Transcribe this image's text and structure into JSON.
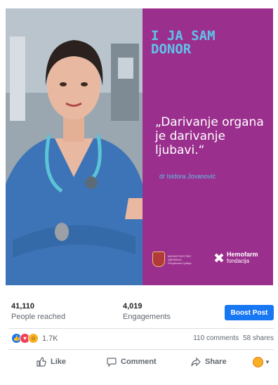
{
  "post": {
    "campaign_title_line1": "I JA SAM",
    "campaign_title_line2": "DONOR",
    "quote": "„Darivanje organa je darivanje ljubavi.“",
    "author": "dr Isidora Jovanović",
    "ministry_text": "МИНИСТАРСТВО ЗДРАВЉА Република Србија",
    "hemofarm_name": "Hemofarm",
    "hemofarm_sub": "fondacija",
    "colors": {
      "campaign_bg": "#9b2f8e",
      "accent": "#5fc2ea"
    }
  },
  "stats": {
    "reached_value": "41,110",
    "reached_label": "People reached",
    "engagements_value": "4,019",
    "engagements_label": "Engagements",
    "boost_label": "Boost Post"
  },
  "reactions": {
    "count": "1.7K",
    "comments": "110 comments",
    "shares": "58 shares",
    "icons": [
      "like-icon",
      "love-icon",
      "haha-icon"
    ]
  },
  "actions": {
    "like": "Like",
    "comment": "Comment",
    "share": "Share"
  }
}
